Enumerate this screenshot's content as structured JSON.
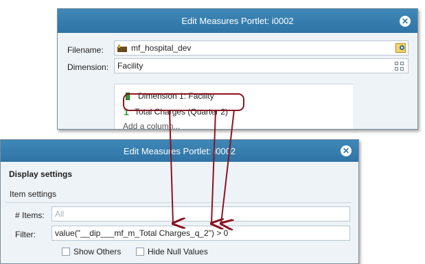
{
  "top_dialog": {
    "title": "Edit Measures Portlet: i0002",
    "close_glyph": "✕",
    "filename_label": "Filename:",
    "filename_value": "mf_hospital_dev",
    "dimension_label": "Dimension:",
    "dimension_value": "Facility",
    "columns": [
      {
        "label": "Dimension 1: Facility",
        "icon": "green-bar-icon"
      },
      {
        "marker": "1",
        "label": "Total Charges (Quarter 2)",
        "icon": "number-one-icon"
      }
    ],
    "add_column": "Add a column..."
  },
  "bottom_dialog": {
    "title": "Edit Measures Portlet: i0002",
    "close_glyph": "✕",
    "display_settings": "Display settings",
    "item_settings": "Item settings",
    "items_label": "# Items:",
    "items_placeholder": "All",
    "filter_label": "Filter:",
    "filter_value": "value(\"__dip___mf_m_Total Charges_q_2\") > 0",
    "show_others": "Show Others",
    "hide_null": "Hide Null Values"
  },
  "colors": {
    "titlebar": "#2f74a4",
    "annotation": "#8b1220",
    "panel": "#eef3f7"
  }
}
